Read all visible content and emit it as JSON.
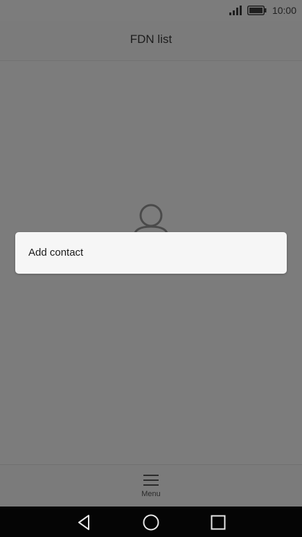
{
  "status_bar": {
    "time": "10:00",
    "icons": [
      "signal-icon",
      "battery-icon"
    ]
  },
  "header": {
    "title": "FDN list"
  },
  "main": {
    "empty_state_icon": "person-icon"
  },
  "popup_menu": {
    "items": [
      {
        "label": "Add contact"
      }
    ]
  },
  "bottom_toolbar": {
    "menu_label": "Menu",
    "menu_icon": "hamburger-icon"
  },
  "nav_bar": {
    "icons": [
      "back-icon",
      "home-icon",
      "recents-icon"
    ]
  },
  "colors": {
    "scrim": "#7c7c7c",
    "popup_bg": "#f6f6f6",
    "nav_bg": "#050505"
  }
}
